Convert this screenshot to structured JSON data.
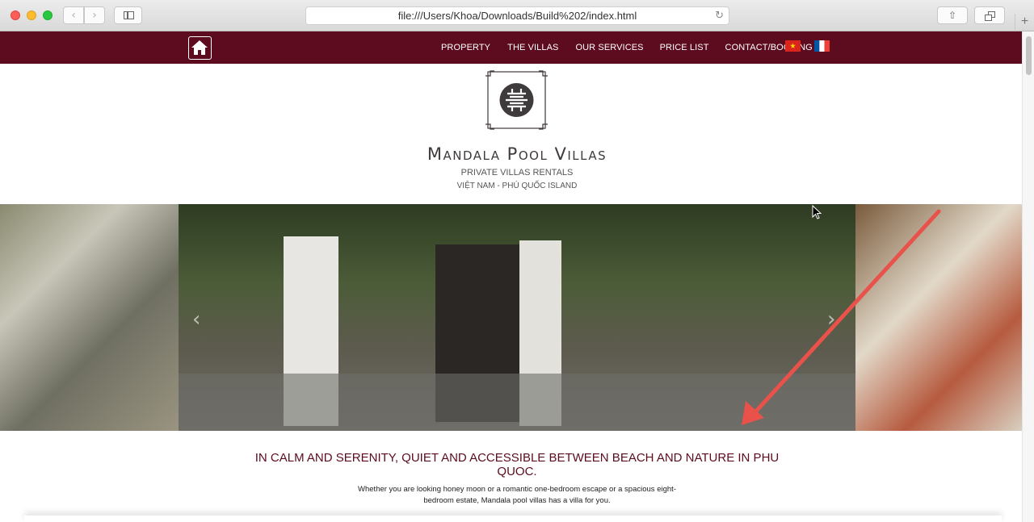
{
  "browser": {
    "url": "file:///Users/Khoa/Downloads/Build%202/index.html"
  },
  "site": {
    "nav": {
      "items": [
        {
          "label": "PROPERTY"
        },
        {
          "label": "THE VILLAS"
        },
        {
          "label": "OUR SERVICES"
        },
        {
          "label": "PRICE LIST"
        },
        {
          "label": "CONTACT/BOOKING"
        }
      ],
      "languages": [
        "vietnamese-flag-icon",
        "french-flag-icon"
      ]
    },
    "brand": {
      "name": "Mandala Pool Villas",
      "tagline": "PRIVATE VILLAS RENTALS",
      "location": "VIỆT NAM - PHÚ QUỐC ISLAND"
    },
    "headline": "IN CALM AND SERENITY, QUIET AND ACCESSIBLE BETWEEN BEACH AND NATURE IN PHU QUOC.",
    "intro": "Whether you are looking honey moon or a romantic one-bedroom escape or a spacious eight-bedroom estate, Mandala pool villas has a villa for you.",
    "colors": {
      "brand": "#5d0b1e",
      "annotation_arrow": "#e8524a"
    }
  }
}
